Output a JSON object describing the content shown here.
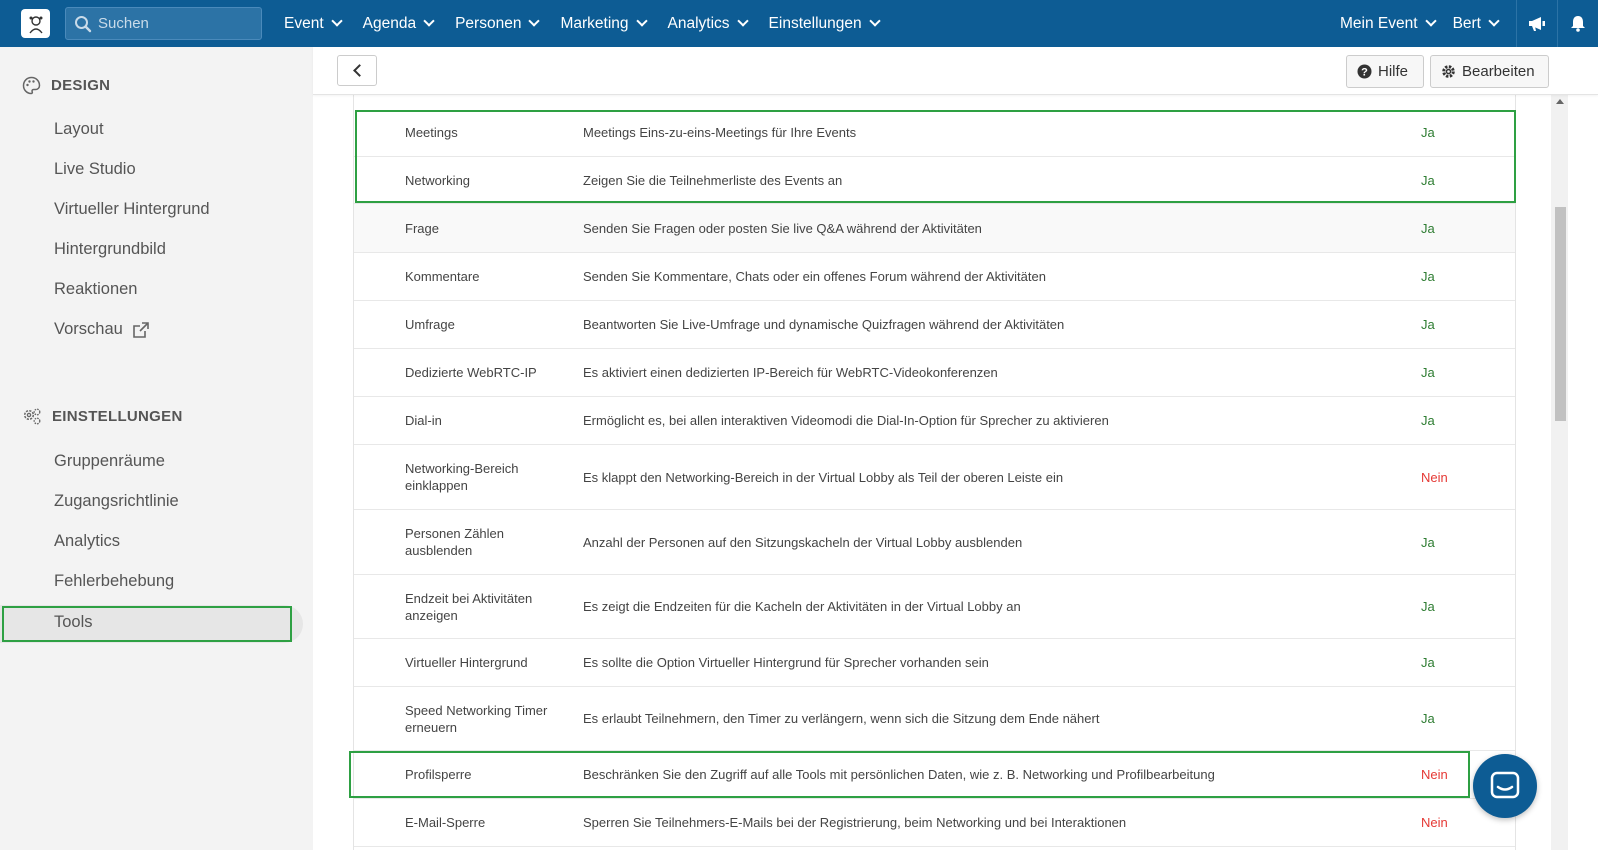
{
  "topbar": {
    "search_placeholder": "Suchen",
    "nav": [
      "Event",
      "Agenda",
      "Personen",
      "Marketing",
      "Analytics",
      "Einstellungen"
    ],
    "right": [
      "Mein Event",
      "Bert"
    ]
  },
  "sidebar": {
    "design_heading": "DESIGN",
    "design_items": [
      "Layout",
      "Live Studio",
      "Virtueller Hintergrund",
      "Hintergrundbild",
      "Reaktionen",
      "Vorschau"
    ],
    "settings_heading": "EINSTELLUNGEN",
    "settings_items": [
      "Gruppenräume",
      "Zugangsrichtlinie",
      "Analytics",
      "Fehlerbehebung",
      "Tools"
    ],
    "active_item": "Tools"
  },
  "toolbar": {
    "help_label": "Hilfe",
    "edit_label": "Bearbeiten"
  },
  "rows": [
    {
      "name": "Meetings",
      "desc": "Meetings Eins-zu-eins-Meetings für Ihre Events",
      "value": "Ja"
    },
    {
      "name": "Networking",
      "desc": "Zeigen Sie die Teilnehmerliste des Events an",
      "value": "Ja"
    },
    {
      "name": "Frage",
      "desc": "Senden Sie Fragen oder posten Sie live Q&A während der Aktivitäten",
      "value": "Ja"
    },
    {
      "name": "Kommentare",
      "desc": "Senden Sie Kommentare, Chats oder ein offenes Forum während der Aktivitäten",
      "value": "Ja"
    },
    {
      "name": "Umfrage",
      "desc": "Beantworten Sie Live-Umfrage und dynamische Quizfragen während der Aktivitäten",
      "value": "Ja"
    },
    {
      "name": "Dedizierte WebRTC-IP",
      "desc": "Es aktiviert einen dedizierten IP-Bereich für WebRTC-Videokonferenzen",
      "value": "Ja"
    },
    {
      "name": "Dial-in",
      "desc": "Ermöglicht es, bei allen interaktiven Videomodi die Dial-In-Option für Sprecher zu aktivieren",
      "value": "Ja"
    },
    {
      "name": "Networking-Bereich einklappen",
      "desc": "Es klappt den Networking-Bereich in der Virtual Lobby als Teil der oberen Leiste ein",
      "value": "Nein"
    },
    {
      "name": "Personen Zählen ausblenden",
      "desc": "Anzahl der Personen auf den Sitzungskacheln der Virtual Lobby ausblenden",
      "value": "Ja"
    },
    {
      "name": "Endzeit bei Aktivitäten anzeigen",
      "desc": "Es zeigt die Endzeiten für die Kacheln der Aktivitäten in der Virtual Lobby an",
      "value": "Ja"
    },
    {
      "name": "Virtueller Hintergrund",
      "desc": "Es sollte die Option Virtueller Hintergrund für Sprecher vorhanden sein",
      "value": "Ja"
    },
    {
      "name": "Speed Networking Timer erneuern",
      "desc": "Es erlaubt Teilnehmern, den Timer zu verlängern, wenn sich die Sitzung dem Ende nähert",
      "value": "Ja"
    },
    {
      "name": "Profilsperre",
      "desc": "Beschränken Sie den Zugriff auf alle Tools mit persönlichen Daten, wie z. B. Networking und Profilbearbeitung",
      "value": "Nein"
    },
    {
      "name": "E-Mail-Sperre",
      "desc": "Sperren Sie Teilnehmers-E-Mails bei der Registrierung, beim Networking und bei Interaktionen",
      "value": "Nein"
    }
  ],
  "colors": {
    "nav_bg": "#0d5c94",
    "ja": "#2e7d32",
    "nein": "#e53935",
    "highlight": "#2ea043"
  }
}
